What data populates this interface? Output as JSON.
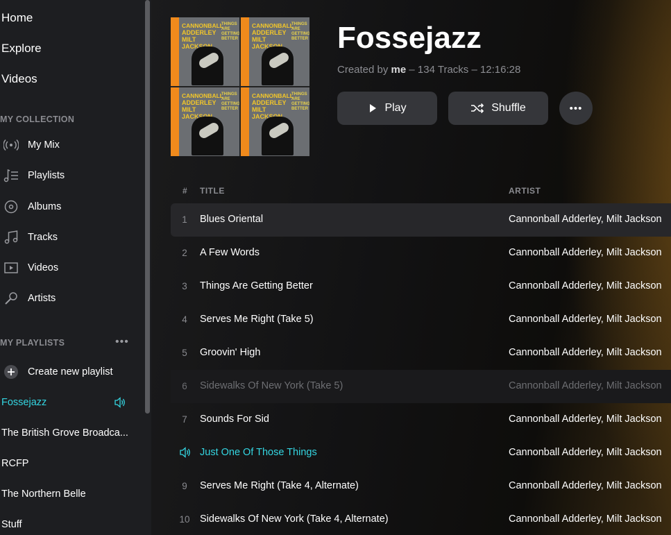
{
  "sidebar": {
    "nav": [
      "Home",
      "Explore",
      "Videos"
    ],
    "collection_heading": "MY COLLECTION",
    "collection": [
      {
        "label": "My Mix",
        "icon": "broadcast-icon"
      },
      {
        "label": "Playlists",
        "icon": "playlist-icon"
      },
      {
        "label": "Albums",
        "icon": "disc-icon"
      },
      {
        "label": "Tracks",
        "icon": "music-note-icon"
      },
      {
        "label": "Videos",
        "icon": "video-icon"
      },
      {
        "label": "Artists",
        "icon": "microphone-icon"
      }
    ],
    "playlists_heading": "MY PLAYLISTS",
    "more": "•••",
    "create_playlist": "Create new playlist",
    "playlists": [
      {
        "label": "Fossejazz",
        "active": true
      },
      {
        "label": "The British Grove Broadca..."
      },
      {
        "label": "RCFP"
      },
      {
        "label": "The Northern Belle"
      },
      {
        "label": "Stuff"
      }
    ]
  },
  "playlist": {
    "title": "Fossejazz",
    "created_by_prefix": "Created by",
    "creator": "me",
    "stats": "– 134 Tracks – 12:16:28",
    "cover_text": {
      "line1": "CANNONBALL",
      "line2": "ADDERLEY",
      "line3": "MILT",
      "line4": "JACKSON",
      "side": "THINGS ARE GETTING BETTER"
    }
  },
  "buttons": {
    "play": "Play",
    "shuffle": "Shuffle",
    "more": "•••"
  },
  "table": {
    "col_num": "#",
    "col_title": "TITLE",
    "col_artist": "ARTIST",
    "rows": [
      {
        "num": "1",
        "title": "Blues Oriental",
        "artist": "Cannonball Adderley, Milt Jackson",
        "state": "highlighted"
      },
      {
        "num": "2",
        "title": "A Few Words",
        "artist": "Cannonball Adderley, Milt Jackson"
      },
      {
        "num": "3",
        "title": "Things Are Getting Better",
        "artist": "Cannonball Adderley, Milt Jackson"
      },
      {
        "num": "4",
        "title": "Serves Me Right (Take 5)",
        "artist": "Cannonball Adderley, Milt Jackson"
      },
      {
        "num": "5",
        "title": "Groovin' High",
        "artist": "Cannonball Adderley, Milt Jackson"
      },
      {
        "num": "6",
        "title": "Sidewalks Of New York (Take 5)",
        "artist": "Cannonball Adderley, Milt Jackson",
        "state": "dimmed"
      },
      {
        "num": "7",
        "title": "Sounds For Sid",
        "artist": "Cannonball Adderley, Milt Jackson"
      },
      {
        "num": "",
        "title": "Just One Of Those Things",
        "artist": "Cannonball Adderley, Milt Jackson",
        "state": "playing"
      },
      {
        "num": "9",
        "title": "Serves Me Right (Take 4, Alternate)",
        "artist": "Cannonball Adderley, Milt Jackson"
      },
      {
        "num": "10",
        "title": "Sidewalks Of New York (Take 4, Alternate)",
        "artist": "Cannonball Adderley, Milt Jackson"
      }
    ]
  },
  "colors": {
    "accent": "#34d6e2",
    "sidebar_bg": "#1d1e21",
    "button_bg": "#35363a"
  }
}
